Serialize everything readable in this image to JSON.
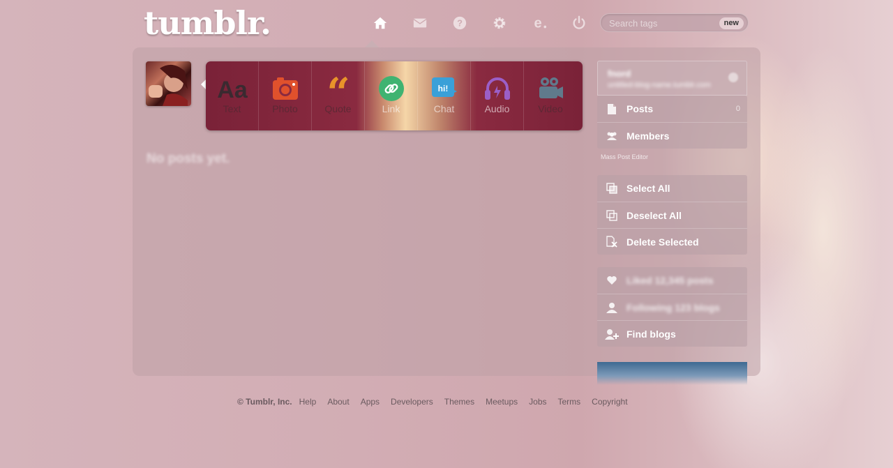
{
  "header": {
    "logo": "tumblr.",
    "nav": [
      {
        "name": "dashboard",
        "icon": "home-icon"
      },
      {
        "name": "messages",
        "icon": "envelope-icon"
      },
      {
        "name": "help",
        "icon": "question-icon"
      },
      {
        "name": "preferences",
        "icon": "gear-icon"
      },
      {
        "name": "extension",
        "icon": "e-icon"
      },
      {
        "name": "logout",
        "icon": "power-icon"
      }
    ],
    "search": {
      "placeholder": "Search tags",
      "badge": "new"
    }
  },
  "post_types": [
    {
      "label": "Text",
      "icon": "text-icon",
      "color": "#3a3a3a"
    },
    {
      "label": "Photo",
      "icon": "camera-icon",
      "color": "#e0512c"
    },
    {
      "label": "Quote",
      "icon": "quote-icon",
      "color": "#e8932a"
    },
    {
      "label": "Link",
      "icon": "link-icon",
      "color": "#3fb371"
    },
    {
      "label": "Chat",
      "icon": "chat-icon",
      "color": "#3aa0d8"
    },
    {
      "label": "Audio",
      "icon": "headphones-icon",
      "color": "#9b5fc8"
    },
    {
      "label": "Video",
      "icon": "video-camera-icon",
      "color": "#607a8c"
    }
  ],
  "main": {
    "empty_message": "No posts yet."
  },
  "sidebar": {
    "blog_card": {
      "title": "fnord",
      "subtitle": "untitled-blog-name.tumblr.com"
    },
    "blog_menu": [
      {
        "label": "Posts",
        "icon": "page-icon",
        "count": "0"
      },
      {
        "label": "Members",
        "icon": "members-icon"
      }
    ],
    "section_label": "Mass Post Editor",
    "editor_menu": [
      {
        "label": "Select All",
        "icon": "select-all-icon"
      },
      {
        "label": "Deselect All",
        "icon": "deselect-all-icon"
      },
      {
        "label": "Delete Selected",
        "icon": "delete-selected-icon"
      }
    ],
    "account_menu": [
      {
        "label": "Liked 12,345 posts",
        "icon": "heart-icon"
      },
      {
        "label": "Following 123 blogs",
        "icon": "user-icon"
      },
      {
        "label": "Find blogs",
        "icon": "add-user-icon"
      }
    ]
  },
  "footer": {
    "copyright": "© Tumblr, Inc.",
    "links": [
      "Help",
      "About",
      "Apps",
      "Developers",
      "Themes",
      "Meetups",
      "Jobs",
      "Terms",
      "Copyright"
    ]
  }
}
